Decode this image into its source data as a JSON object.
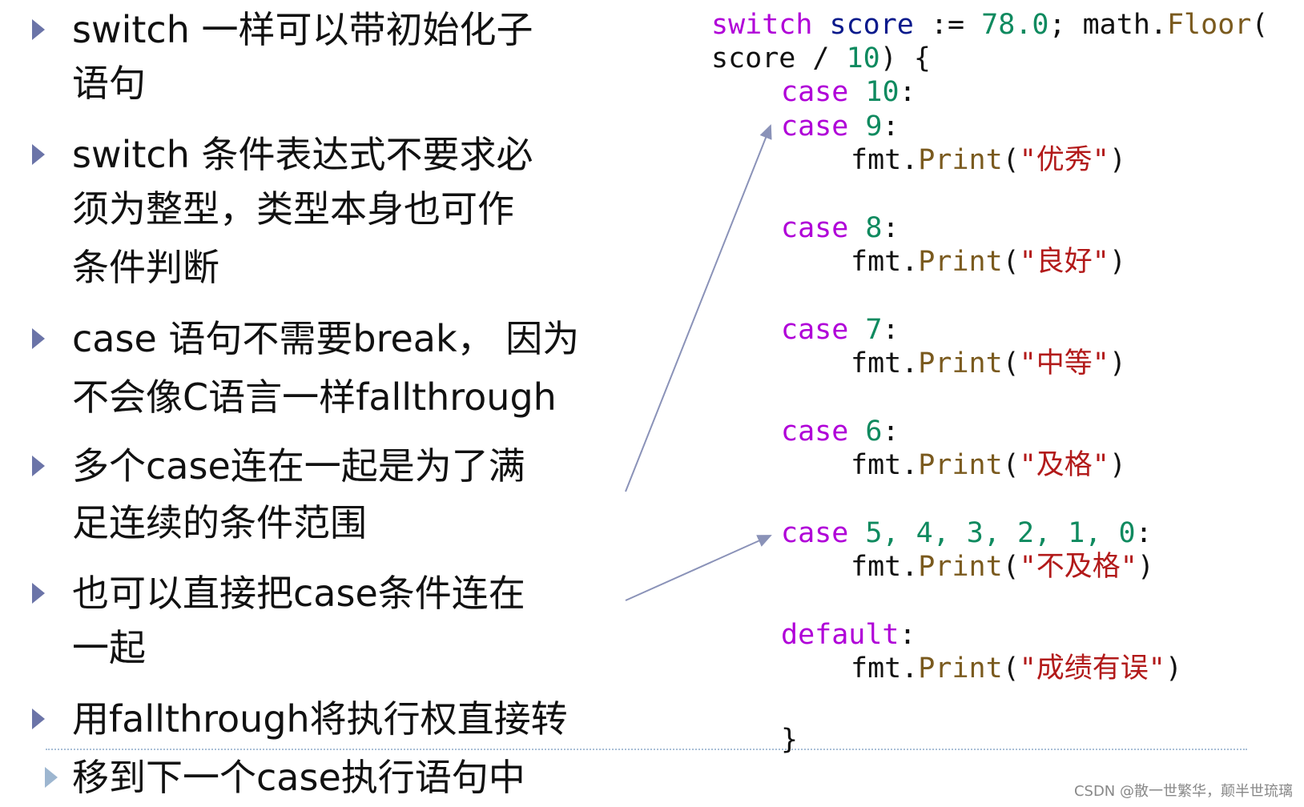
{
  "bullets": [
    {
      "lines": [
        "switch 一样可以带初始化子",
        "语句"
      ]
    },
    {
      "lines": [
        "switch 条件表达式不要求必",
        "须为整型，类型本身也可作",
        "条件判断"
      ]
    },
    {
      "lines": [
        "case 语句不需要break， 因为",
        "不会像C语言一样fallthrough"
      ]
    },
    {
      "lines": [
        "多个case连在一起是为了满",
        "足连续的条件范围"
      ]
    },
    {
      "lines": [
        "也可以直接把case条件连在",
        "一起"
      ]
    },
    {
      "lines": [
        "用fallthrough将执行权直接转"
      ]
    },
    {
      "lines": [
        "移到下一个case执行语句中"
      ]
    }
  ],
  "code": {
    "l1": {
      "kw": "switch",
      "id": "score",
      "op": " := ",
      "num": "78.0",
      "rest": "; math.",
      "fn": "Floor",
      "paren": "("
    },
    "l2": {
      "a": "score / ",
      "num": "10",
      "b": ") {"
    },
    "cases": [
      {
        "kw": "case",
        "vals": "10",
        "colon": ":",
        "body": null
      },
      {
        "kw": "case",
        "vals": "9",
        "colon": ":",
        "body": "\"优秀\""
      },
      {
        "kw": "case",
        "vals": "8",
        "colon": ":",
        "body": "\"良好\""
      },
      {
        "kw": "case",
        "vals": "7",
        "colon": ":",
        "body": "\"中等\""
      },
      {
        "kw": "case",
        "vals": "6",
        "colon": ":",
        "body": "\"及格\""
      },
      {
        "kw": "case",
        "vals": "5, 4, 3, 2, 1, 0",
        "colon": ":",
        "body": "\"不及格\""
      },
      {
        "kw": "default",
        "vals": "",
        "colon": ":",
        "body": "\"成绩有误\""
      }
    ],
    "fmt": "fmt.",
    "print": "Print",
    "open": "(",
    "close": ")",
    "end": "}"
  },
  "watermark": "CSDN @散一世繁华，颠半世琉璃",
  "colors": {
    "keyword": "#b000d8",
    "number": "#0f8a5f",
    "string": "#b21a1a",
    "function": "#7a5a1e",
    "arrow": "#8a92b8"
  }
}
